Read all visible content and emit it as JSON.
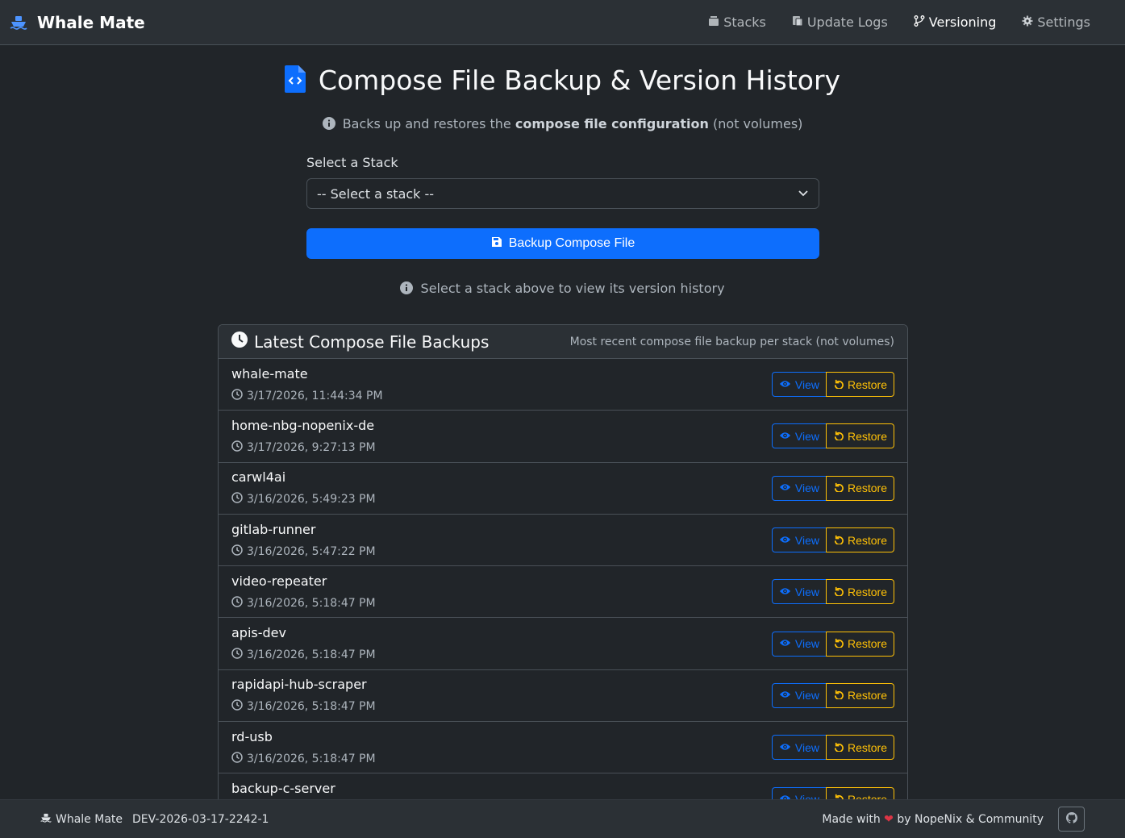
{
  "app": {
    "name": "Whale Mate"
  },
  "nav": {
    "items": [
      {
        "label": "Stacks",
        "icon": "layers-icon"
      },
      {
        "label": "Update Logs",
        "icon": "logs-icon"
      },
      {
        "label": "Versioning",
        "icon": "branch-icon",
        "active": true
      },
      {
        "label": "Settings",
        "icon": "gear-icon"
      }
    ]
  },
  "page": {
    "title": "Compose File Backup & Version History",
    "subtitle_pre": "Backs up and restores the",
    "subtitle_bold": "compose file configuration",
    "subtitle_post": "(not volumes)",
    "select_label": "Select a Stack",
    "select_value": "-- Select a stack --",
    "backup_button": "Backup Compose File",
    "hint": "Select a stack above to view its version history"
  },
  "latest": {
    "title": "Latest Compose File Backups",
    "note": "Most recent compose file backup per stack (not volumes)",
    "view_label": "View",
    "restore_label": "Restore",
    "rows": [
      {
        "name": "whale-mate",
        "time": "3/17/2026, 11:44:34 PM"
      },
      {
        "name": "home-nbg-nopenix-de",
        "time": "3/17/2026, 9:27:13 PM"
      },
      {
        "name": "carwl4ai",
        "time": "3/16/2026, 5:49:23 PM"
      },
      {
        "name": "gitlab-runner",
        "time": "3/16/2026, 5:47:22 PM"
      },
      {
        "name": "video-repeater",
        "time": "3/16/2026, 5:18:47 PM"
      },
      {
        "name": "apis-dev",
        "time": "3/16/2026, 5:18:47 PM"
      },
      {
        "name": "rapidapi-hub-scraper",
        "time": "3/16/2026, 5:18:47 PM"
      },
      {
        "name": "rd-usb",
        "time": "3/16/2026, 5:18:47 PM"
      },
      {
        "name": "backup-c-server",
        "time": ""
      }
    ]
  },
  "footer": {
    "app_name": "Whale Mate",
    "version": "DEV-2026-03-17-2242-1",
    "made_with": "Made with",
    "by": "by NopeNix & Community"
  },
  "colors": {
    "primary": "#0d6efd",
    "warning": "#ffc107",
    "danger": "#dc3545"
  }
}
